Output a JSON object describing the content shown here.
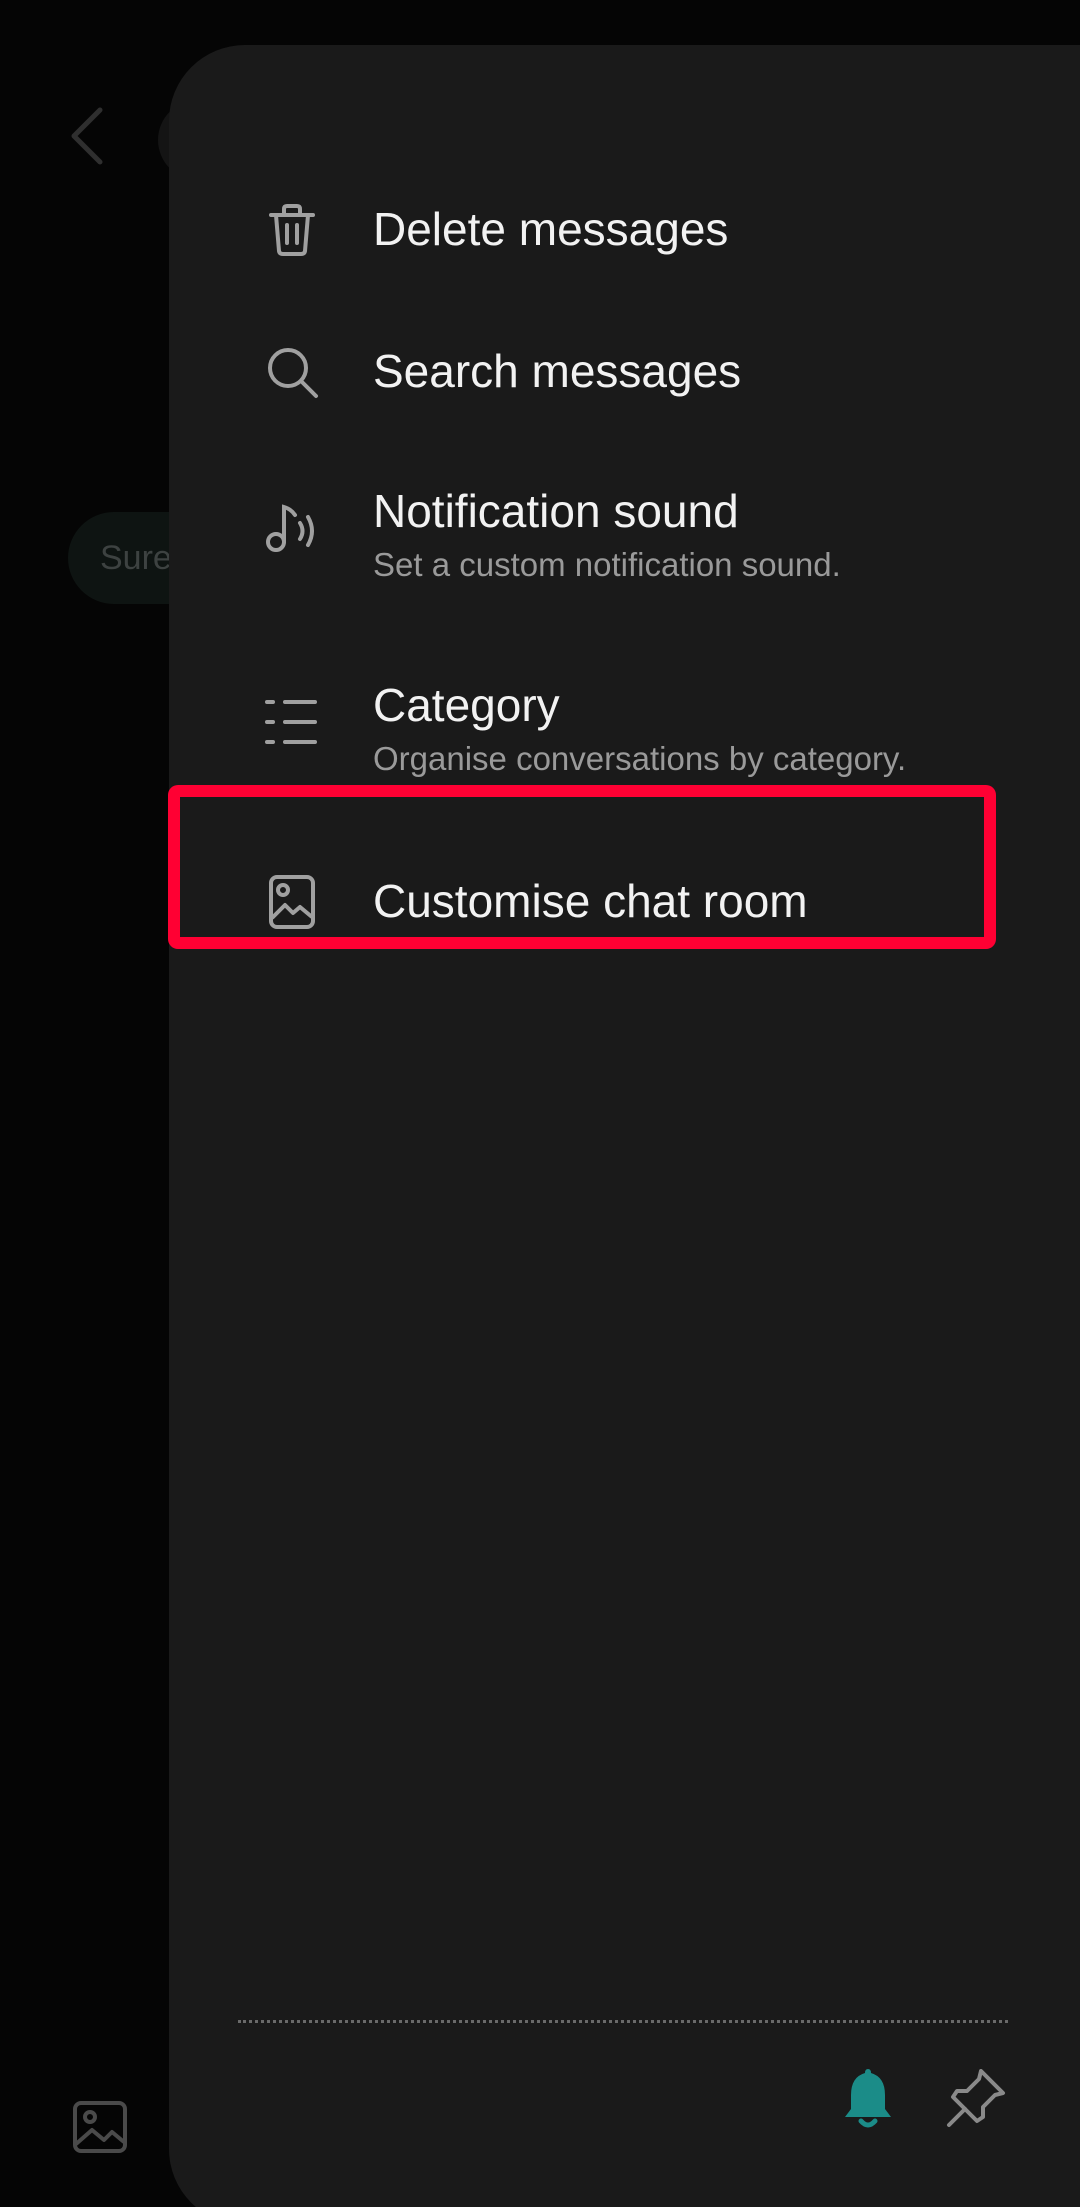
{
  "background": {
    "bubble_text": "Sure"
  },
  "menu": {
    "items": [
      {
        "icon": "trash-icon",
        "title": "Delete messages"
      },
      {
        "icon": "search-icon",
        "title": "Search messages"
      },
      {
        "icon": "music-note-icon",
        "title": "Notification sound",
        "subtitle": "Set a custom notification sound."
      },
      {
        "icon": "list-icon",
        "title": "Category",
        "subtitle": "Organise conversations by category."
      },
      {
        "icon": "image-icon",
        "title": "Customise chat room",
        "highlighted": true
      }
    ]
  },
  "bottom_actions": [
    {
      "icon": "bell-icon",
      "active": true,
      "color": "#1b8c88"
    },
    {
      "icon": "pin-icon",
      "active": false,
      "color": "#8a8a8a"
    }
  ],
  "colors": {
    "drawer_bg": "#1a1a1a",
    "highlight": "#ff0033",
    "accent": "#1b8c88"
  }
}
